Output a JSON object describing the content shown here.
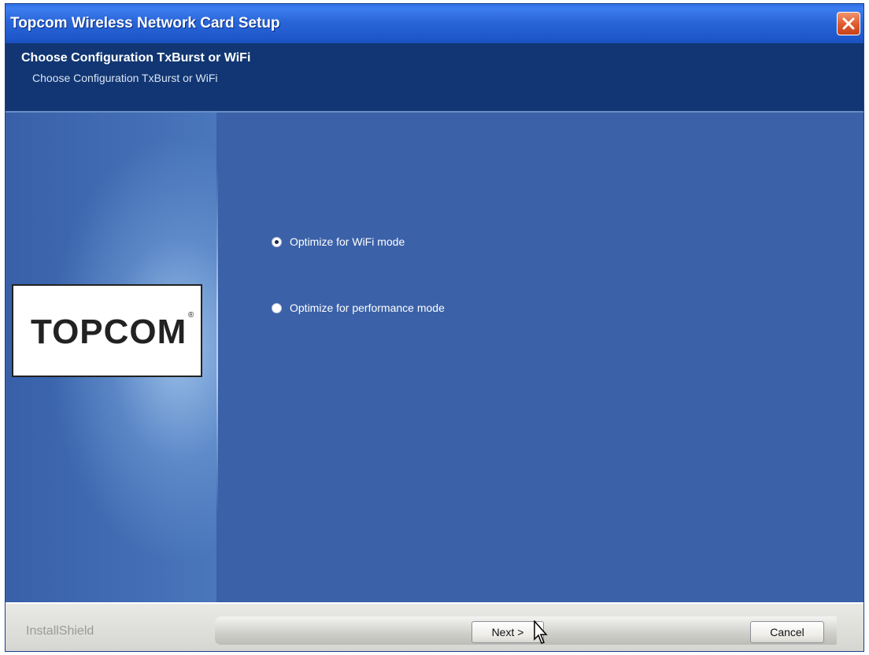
{
  "window": {
    "title": "Topcom Wireless Network Card Setup",
    "close_label": "close"
  },
  "header": {
    "title": "Choose Configuration TxBurst or WiFi",
    "subtitle": "Choose Configuration TxBurst or WiFi"
  },
  "sidebar": {
    "logo_text": "TOPCOM",
    "logo_mark": "®"
  },
  "options": [
    {
      "label": "Optimize for WiFi mode",
      "selected": true
    },
    {
      "label": "Optimize for performance mode",
      "selected": false
    }
  ],
  "footer": {
    "brand": "InstallShield",
    "next_label": "Next >",
    "cancel_label": "Cancel"
  },
  "colors": {
    "panel": "#3b61a8",
    "header": "#113673",
    "titlebar": "#1e58cc"
  }
}
